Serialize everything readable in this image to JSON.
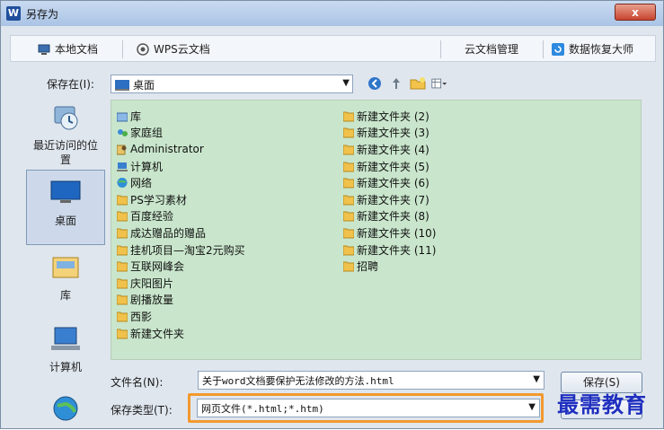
{
  "window": {
    "title": "另存为",
    "close_label": "x"
  },
  "topbar": {
    "local_docs": "本地文档",
    "wps_cloud": "WPS云文档",
    "cloud_manage": "云文档管理",
    "data_recovery": "数据恢复大师"
  },
  "savein": {
    "label": "保存在(I):",
    "value": "桌面"
  },
  "places": [
    {
      "label": "最近访问的位置"
    },
    {
      "label": "桌面"
    },
    {
      "label": "库"
    },
    {
      "label": "计算机"
    }
  ],
  "files_left": [
    "库",
    "家庭组",
    "Administrator",
    "计算机",
    "网络",
    "PS学习素材",
    "百度经验",
    "成达赠品的赠品",
    "挂机项目—淘宝2元购买",
    "互联网峰会",
    "庆阳图片",
    "剧播放量",
    "西影",
    "新建文件夹"
  ],
  "files_right": [
    "新建文件夹 (2)",
    "新建文件夹 (3)",
    "新建文件夹 (4)",
    "新建文件夹 (5)",
    "新建文件夹 (6)",
    "新建文件夹 (7)",
    "新建文件夹 (8)",
    "新建文件夹 (10)",
    "新建文件夹 (11)",
    "招聘"
  ],
  "filename": {
    "label": "文件名(N):",
    "value": "关于word文档要保护无法修改的方法.html"
  },
  "filetype": {
    "label": "保存类型(T):",
    "value": "网页文件(*.html;*.htm)"
  },
  "buttons": {
    "save": "保存(S)"
  },
  "watermark": "最需教育",
  "colors": {
    "list_bg": "#c9e6cc",
    "highlight": "#f2992e",
    "watermark": "#1f2fbf"
  }
}
